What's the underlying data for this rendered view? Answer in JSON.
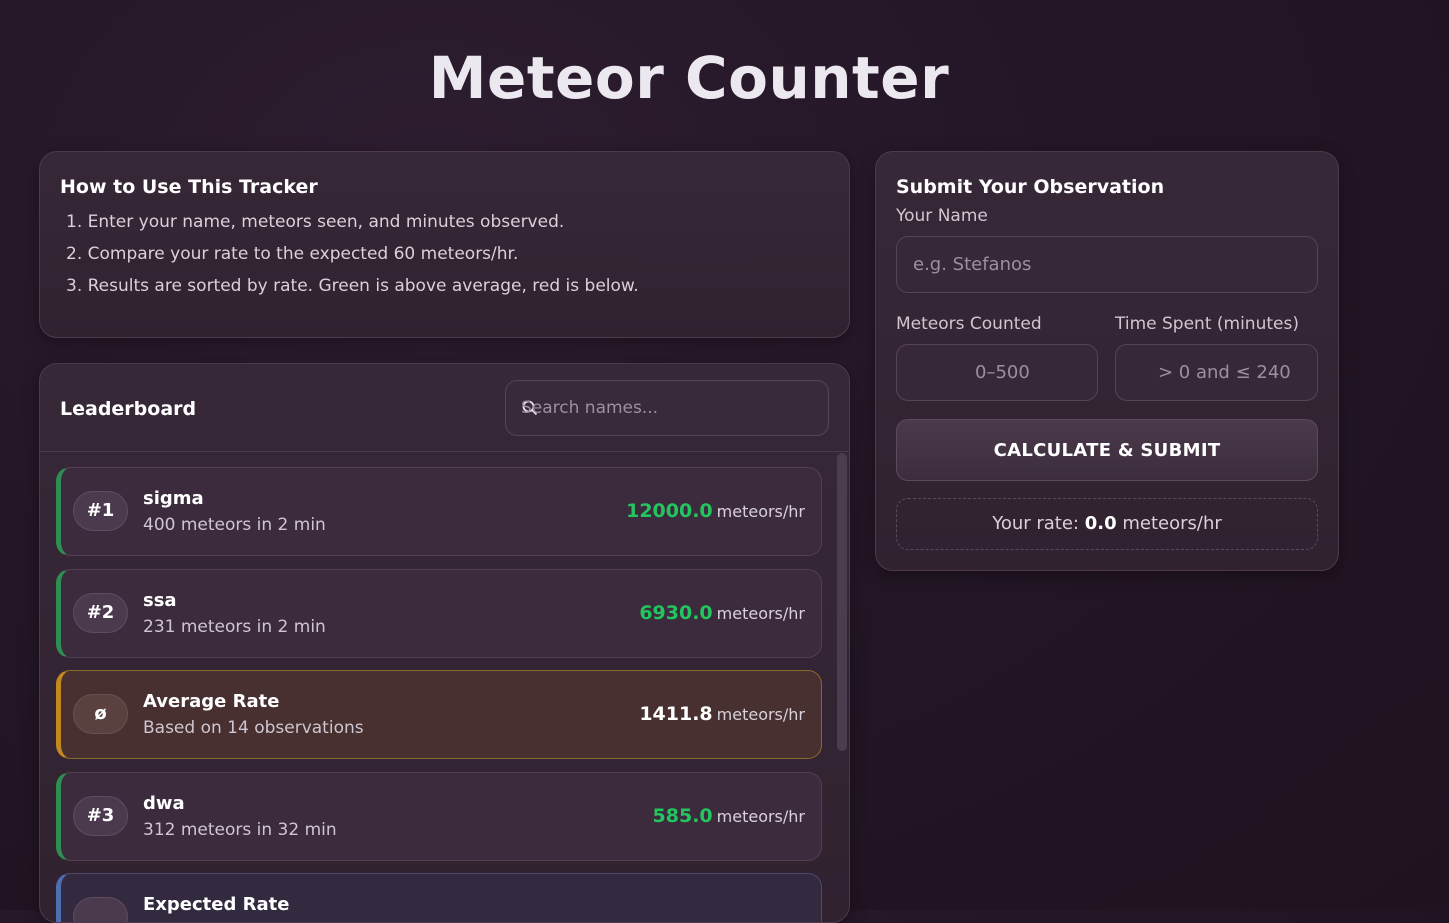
{
  "page": {
    "title": "Meteor Counter"
  },
  "howto": {
    "title": "How to Use This Tracker",
    "steps": [
      "1. Enter your name, meteors seen, and minutes observed.",
      "2. Compare your rate to the expected 60 meteors/hr.",
      "3. Results are sorted by rate. Green is above average, red is below."
    ]
  },
  "leaderboard": {
    "title": "Leaderboard",
    "search_placeholder": "Search names...",
    "unit": "meteors/hr",
    "rows": [
      {
        "badge": "#1",
        "name": "sigma",
        "detail": "400 meteors in 2 min",
        "rate": "12000.0"
      },
      {
        "badge": "#2",
        "name": "ssa",
        "detail": "231 meteors in 2 min",
        "rate": "6930.0"
      },
      {
        "badge": "ø",
        "name": "Average Rate",
        "detail": "Based on 14 observations",
        "rate": "1411.8"
      },
      {
        "badge": "#3",
        "name": "dwa",
        "detail": "312 meteors in 32 min",
        "rate": "585.0"
      },
      {
        "badge": "",
        "name": "Expected Rate",
        "detail": "",
        "rate": ""
      }
    ]
  },
  "submit": {
    "title": "Submit Your Observation",
    "name_label": "Your Name",
    "name_placeholder": "e.g. Stefanos",
    "meteors_label": "Meteors Counted",
    "meteors_placeholder": "0–500",
    "time_label": "Time Spent (minutes)",
    "time_placeholder": "> 0 and ≤ 240",
    "button_label": "CALCULATE & SUBMIT",
    "result_prefix": "Your rate:",
    "result_value": "0.0",
    "result_unit": "meteors/hr"
  },
  "colors": {
    "above_average": "#22c55e",
    "average_accent": "#c4891e",
    "expected_accent": "#4d6fb0"
  }
}
